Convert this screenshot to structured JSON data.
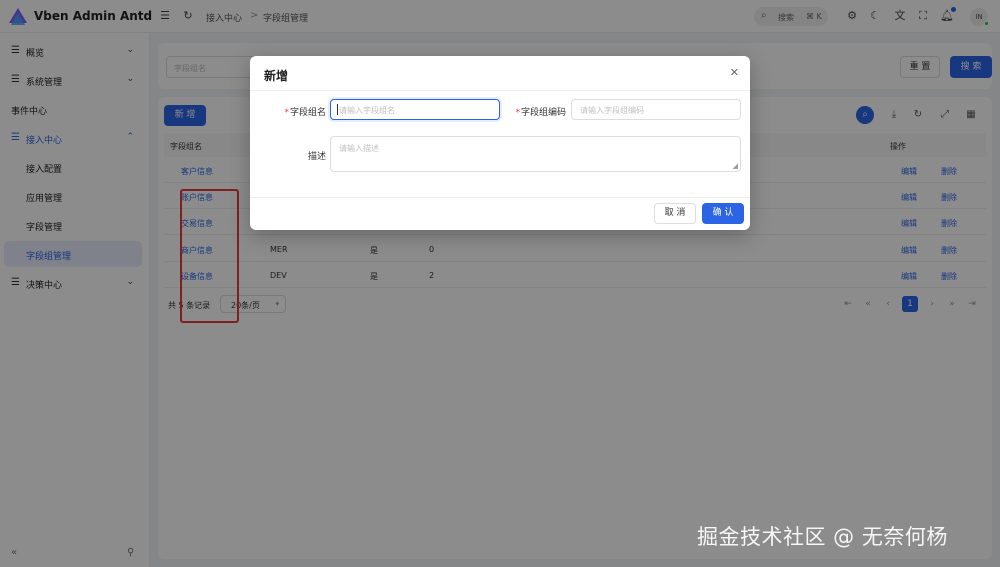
{
  "app": {
    "title": "Vben Admin Antd"
  },
  "header": {
    "breadcrumb": [
      "接入中心",
      "字段组管理"
    ],
    "breadcrumb_sep": ">",
    "search_label": "搜索",
    "search_kbd": "⌘ K",
    "avatar_text": "IN"
  },
  "sidebar": {
    "items": [
      {
        "label": "概览"
      },
      {
        "label": "系统管理"
      },
      {
        "label": "事件中心"
      },
      {
        "label": "接入中心"
      },
      {
        "label": "接入配置"
      },
      {
        "label": "应用管理"
      },
      {
        "label": "字段管理"
      },
      {
        "label": "字段组管理"
      },
      {
        "label": "决策中心"
      }
    ]
  },
  "search_form": {
    "placeholder": "字段组名",
    "reset_label": "重 置",
    "search_label": "搜 索"
  },
  "table": {
    "add_label": "新 增",
    "columns": {
      "name": "字段组名",
      "actions": "操作"
    },
    "rows": [
      {
        "name": "客户信息",
        "code": "",
        "flag": "",
        "count": "",
        "edit": "编辑",
        "delete": "删除"
      },
      {
        "name": "账户信息",
        "code": "",
        "flag": "",
        "count": "",
        "edit": "编辑",
        "delete": "删除"
      },
      {
        "name": "交易信息",
        "code": "",
        "flag": "",
        "count": "",
        "edit": "编辑",
        "delete": "删除"
      },
      {
        "name": "商户信息",
        "code": "MER",
        "flag": "是",
        "count": "0",
        "edit": "编辑",
        "delete": "删除"
      },
      {
        "name": "设备信息",
        "code": "DEV",
        "flag": "是",
        "count": "2",
        "edit": "编辑",
        "delete": "删除"
      }
    ],
    "pagination": {
      "total_text": "共 5 条记录",
      "page_size": "20条/页",
      "current_page": "1"
    }
  },
  "modal": {
    "title": "新增",
    "name_label": "字段组名",
    "name_placeholder": "请输入字段组名",
    "code_label": "字段组编码",
    "code_placeholder": "请输入字段组编码",
    "desc_label": "描述",
    "desc_placeholder": "请输入描述",
    "cancel_label": "取 消",
    "ok_label": "确 认",
    "required_mark": "*"
  },
  "watermark": "掘金技术社区 @ 无奈何杨",
  "colors": {
    "primary": "#2b64e5",
    "highlight": "#e53b3b"
  }
}
